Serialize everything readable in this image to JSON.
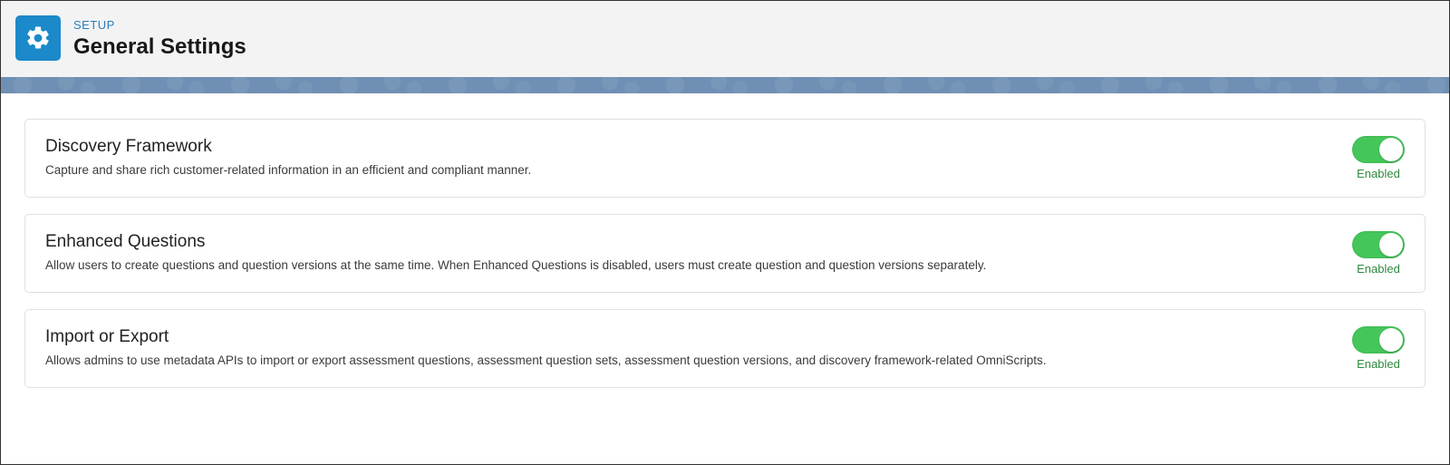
{
  "header": {
    "breadcrumb": "SETUP",
    "title": "General Settings"
  },
  "settings": [
    {
      "title": "Discovery Framework",
      "desc": "Capture and share rich customer-related information in an efficient and compliant manner.",
      "state_label": "Enabled",
      "enabled": true
    },
    {
      "title": "Enhanced Questions",
      "desc": "Allow users to create questions and question versions at the same time. When Enhanced Questions is disabled, users must create question and question versions separately.",
      "state_label": "Enabled",
      "enabled": true
    },
    {
      "title": "Import or Export",
      "desc": "Allows admins to use metadata APIs to import or export assessment questions, assessment question sets, assessment question versions, and discovery framework-related OmniScripts.",
      "state_label": "Enabled",
      "enabled": true
    }
  ]
}
